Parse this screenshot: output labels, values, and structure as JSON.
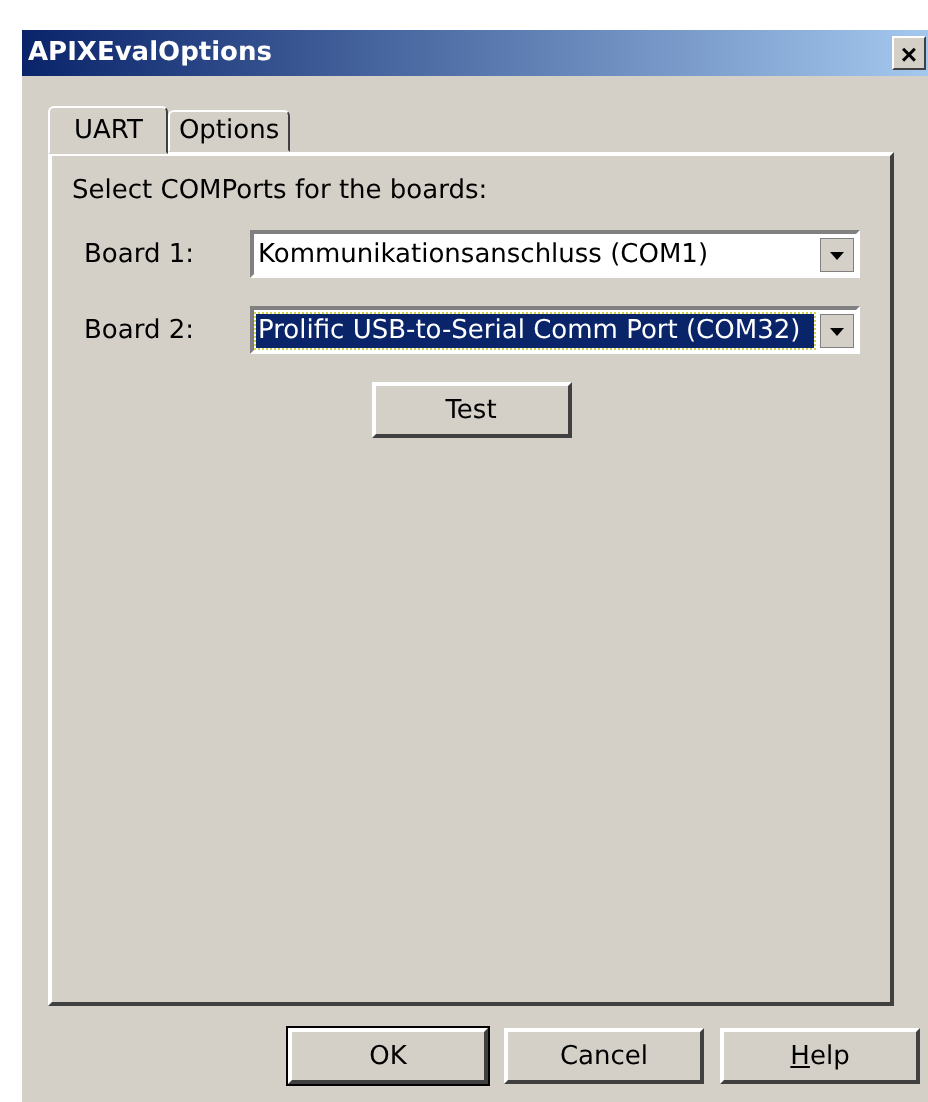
{
  "window": {
    "title": "APIXEvalOptions",
    "close": "×"
  },
  "tabs": [
    {
      "label": "UART",
      "selected": true
    },
    {
      "label": "Options",
      "selected": false
    }
  ],
  "prompt": "Select COMPorts for the boards:",
  "boards": [
    {
      "label": "Board 1:",
      "value": "Kommunikationsanschluss (COM1)",
      "selected": false
    },
    {
      "label": "Board 2:",
      "value": "Prolific USB-to-Serial Comm Port (COM32)",
      "selected": true
    }
  ],
  "test_button": "Test",
  "buttons": [
    {
      "label": "OK",
      "default": true,
      "underline_first": false
    },
    {
      "label": "Cancel",
      "default": false,
      "underline_first": false
    },
    {
      "label": "Help",
      "default": false,
      "underline_first": true
    }
  ]
}
